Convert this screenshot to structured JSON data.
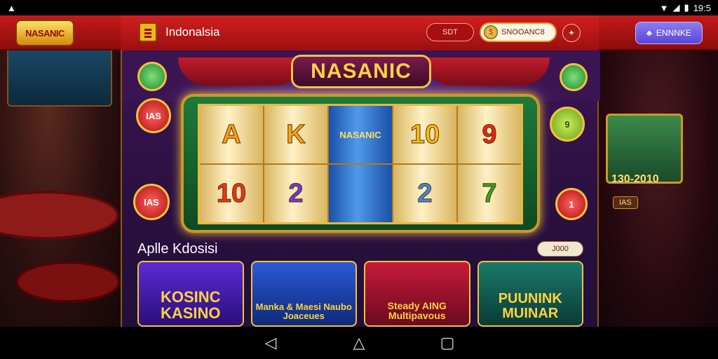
{
  "status_bar": {
    "left_icon": "▲",
    "time": "19:5"
  },
  "topbar": {
    "logo_text": "NASANIC",
    "region_label": "Indonalsia",
    "pill_label": "SDT",
    "balance_text": "SNOOANC8",
    "login_label": "ENNNKE"
  },
  "game": {
    "title": "NASANIC",
    "reels": [
      [
        "A",
        "10"
      ],
      [
        "K",
        "2"
      ],
      [
        "NASANIC",
        ""
      ],
      [
        "10",
        "2"
      ],
      [
        "9",
        "7"
      ]
    ],
    "chips_left": [
      "",
      "IAS",
      "IAS"
    ],
    "chips_right": [
      "",
      "9",
      "1"
    ]
  },
  "right_panel": {
    "jackpot_value": "130-2010",
    "jackpot_label": "IAS"
  },
  "section": {
    "title": "Aplle Kdosisi",
    "see_all": "J000",
    "cards": [
      {
        "title": "KOSINC KASINO",
        "colors": [
          "#5b2bd6",
          "#2a0f7a"
        ]
      },
      {
        "title": "Manka & Maesi Naubo Joaceues",
        "colors": [
          "#2a5ad8",
          "#0e2a7a"
        ]
      },
      {
        "title": "Steady AING Multipavous",
        "colors": [
          "#c81a3a",
          "#6a0a1e"
        ]
      },
      {
        "title": "PUUNINK MUINAR",
        "colors": [
          "#1a7a6a",
          "#0a3a36"
        ]
      }
    ]
  },
  "nav": {
    "back": "◁",
    "home": "△",
    "recents": "▢"
  }
}
